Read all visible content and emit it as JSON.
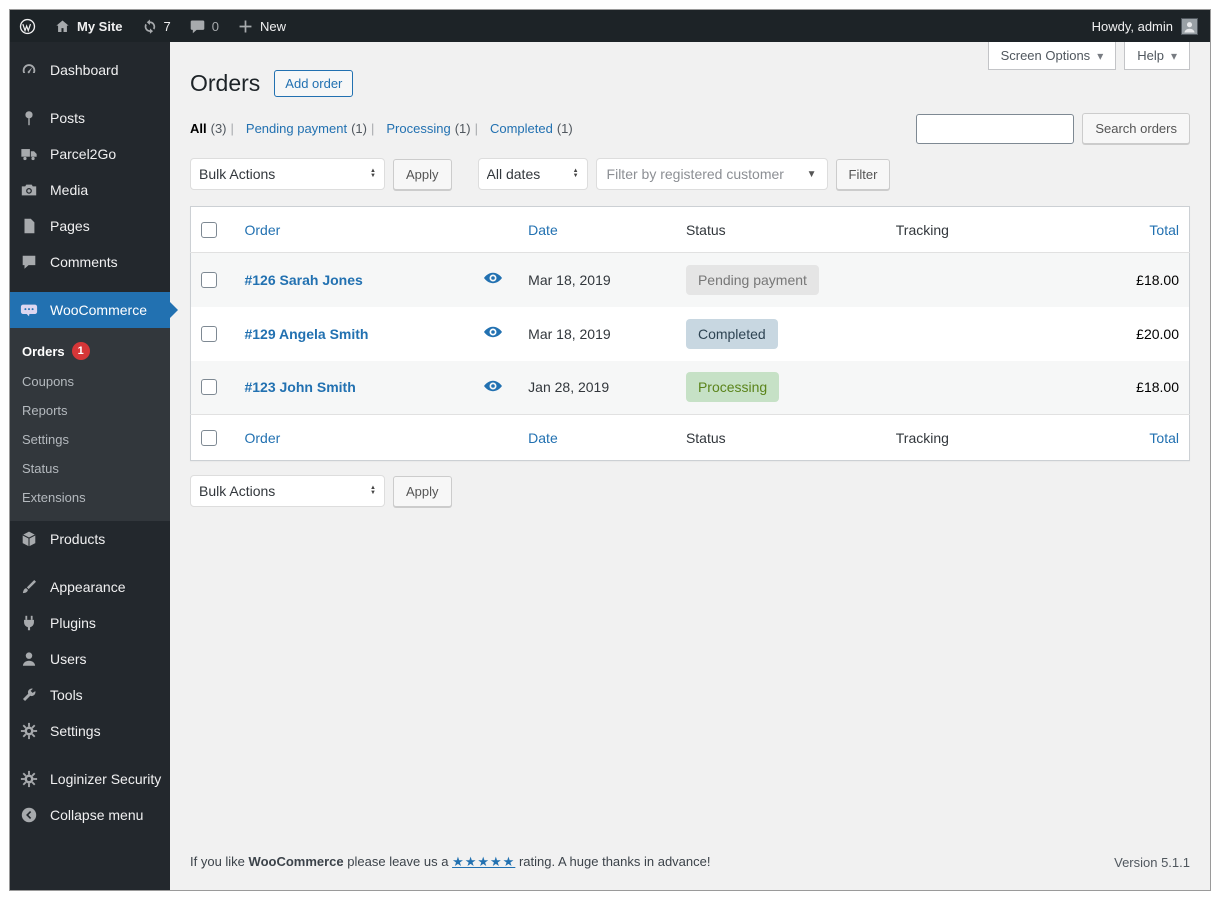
{
  "admin_bar": {
    "site_name": "My Site",
    "updates_count": "7",
    "comments_count": "0",
    "new_label": "New",
    "howdy_text": "Howdy, admin"
  },
  "sidebar": {
    "items": [
      {
        "label": "Dashboard",
        "icon": "dashboard-gauge-icon"
      },
      {
        "label": "Posts",
        "icon": "pushpin-icon"
      },
      {
        "label": "Parcel2Go",
        "icon": "truck-icon"
      },
      {
        "label": "Media",
        "icon": "camera-icon"
      },
      {
        "label": "Pages",
        "icon": "page-icon"
      },
      {
        "label": "Comments",
        "icon": "speech-bubble-icon"
      },
      {
        "label": "WooCommerce",
        "icon": "woocommerce-logo-icon"
      },
      {
        "label": "Products",
        "icon": "box-icon"
      },
      {
        "label": "Appearance",
        "icon": "paintbrush-icon"
      },
      {
        "label": "Plugins",
        "icon": "plug-icon"
      },
      {
        "label": "Users",
        "icon": "person-icon"
      },
      {
        "label": "Tools",
        "icon": "wrench-icon"
      },
      {
        "label": "Settings",
        "icon": "gear-icon"
      },
      {
        "label": "Loginizer Security",
        "icon": "gear-icon"
      },
      {
        "label": "Collapse menu",
        "icon": "collapse-arrow-icon"
      }
    ],
    "woo_submenu": [
      {
        "label": "Orders",
        "badge": "1"
      },
      {
        "label": "Coupons"
      },
      {
        "label": "Reports"
      },
      {
        "label": "Settings"
      },
      {
        "label": "Status"
      },
      {
        "label": "Extensions"
      }
    ]
  },
  "page": {
    "title": "Orders",
    "add_order_label": "Add order",
    "screen_options_label": "Screen Options",
    "help_label": "Help",
    "views": [
      {
        "label": "All",
        "count": "(3)"
      },
      {
        "label": "Pending payment",
        "count": "(1)"
      },
      {
        "label": "Processing",
        "count": "(1)"
      },
      {
        "label": "Completed",
        "count": "(1)"
      }
    ],
    "search_button_label": "Search orders",
    "bulk_actions_label": "Bulk Actions",
    "apply_label": "Apply",
    "all_dates_label": "All dates",
    "customer_filter_placeholder": "Filter by registered customer",
    "filter_label": "Filter"
  },
  "table": {
    "columns": {
      "order": "Order",
      "date": "Date",
      "status": "Status",
      "tracking": "Tracking",
      "total": "Total"
    },
    "rows": [
      {
        "order": "#126 Sarah Jones",
        "date": "Mar 18, 2019",
        "status": "Pending payment",
        "status_key": "pending",
        "tracking": "",
        "total": "£18.00"
      },
      {
        "order": "#129 Angela Smith",
        "date": "Mar 18, 2019",
        "status": "Completed",
        "status_key": "completed",
        "tracking": "",
        "total": "£20.00"
      },
      {
        "order": "#123 John Smith",
        "date": "Jan 28, 2019",
        "status": "Processing",
        "status_key": "processing",
        "tracking": "",
        "total": "£18.00"
      }
    ]
  },
  "footer": {
    "text_prefix": "If you like ",
    "brand": "WooCommerce",
    "text_mid": " please leave us a ",
    "stars": "★★★★★",
    "text_suffix": " rating. A huge thanks in advance!",
    "version": "Version 5.1.1"
  },
  "colors": {
    "accent": "#2271b1",
    "admin_bar_bg": "#1d2327",
    "sidebar_bg": "#23282d",
    "submenu_bg": "#32373c",
    "content_bg": "#f1f1f1",
    "badge_red": "#d63638",
    "status_pending_bg": "#e5e5e5",
    "status_completed_bg": "#c8d7e1",
    "status_processing_bg": "#c6e1c6"
  }
}
